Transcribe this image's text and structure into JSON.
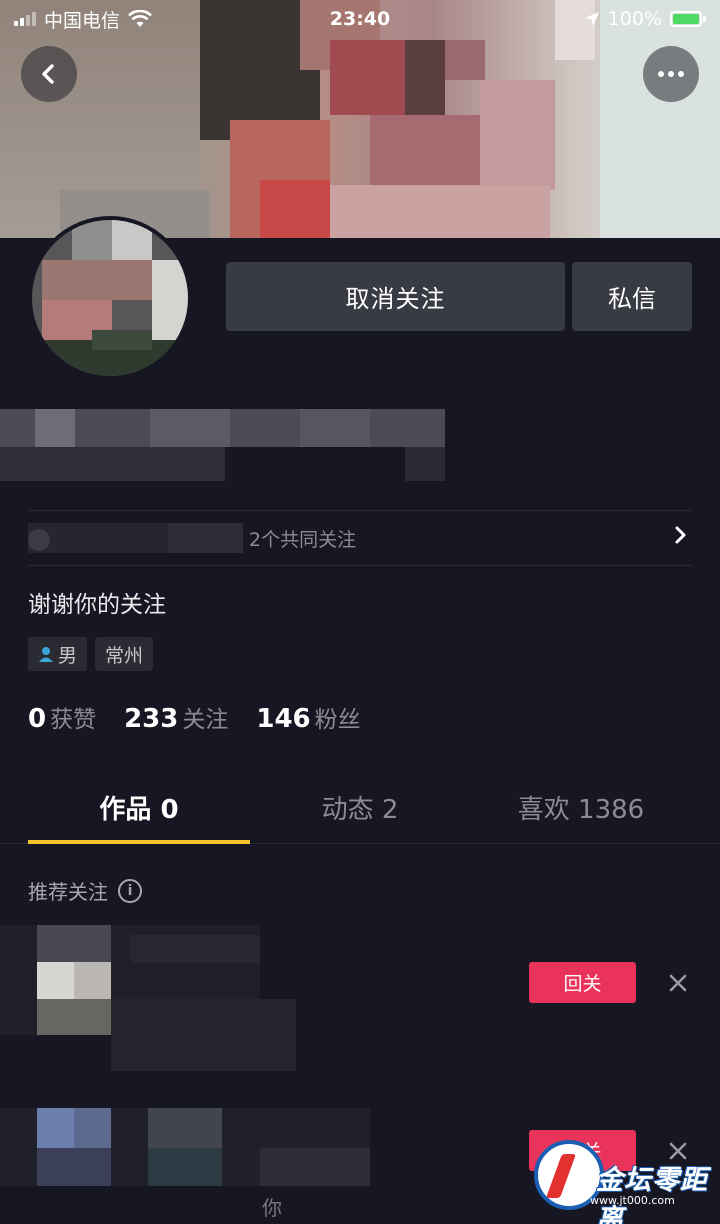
{
  "status_bar": {
    "carrier": "中国电信",
    "time": "23:40",
    "battery_percent": "100%",
    "battery_level": 1.0,
    "icons": [
      "signal-icon",
      "wifi-icon",
      "location-arrow-icon",
      "battery-charging-icon"
    ]
  },
  "header": {
    "back_icon": "chevron-left-icon",
    "more_icon": "ellipsis-icon"
  },
  "profile": {
    "unfollow_label": "取消关注",
    "message_label": "私信",
    "mutual_text": "2个共同关注",
    "bio": "谢谢你的关注",
    "tags": [
      {
        "icon": "male-user-icon",
        "label": "男"
      },
      {
        "label": "常州"
      }
    ],
    "stats": [
      {
        "value": "0",
        "label": "获赞"
      },
      {
        "value": "233",
        "label": "关注"
      },
      {
        "value": "146",
        "label": "粉丝"
      }
    ]
  },
  "tabs": [
    {
      "label": "作品 0",
      "active": true
    },
    {
      "label": "动态 2",
      "active": false
    },
    {
      "label": "喜欢 1386",
      "active": false
    }
  ],
  "recommendations": {
    "title": "推荐关注",
    "items": [
      {
        "button_label": "回关"
      },
      {
        "button_label": "回关",
        "subtitle": "你"
      }
    ]
  },
  "watermark": {
    "text": "金坛零距离",
    "url": "www.jt000.com"
  },
  "colors": {
    "background": "#161722",
    "button_dark": "#393b44",
    "accent_red": "#e9335a",
    "tab_underline": "#f4c42a"
  }
}
